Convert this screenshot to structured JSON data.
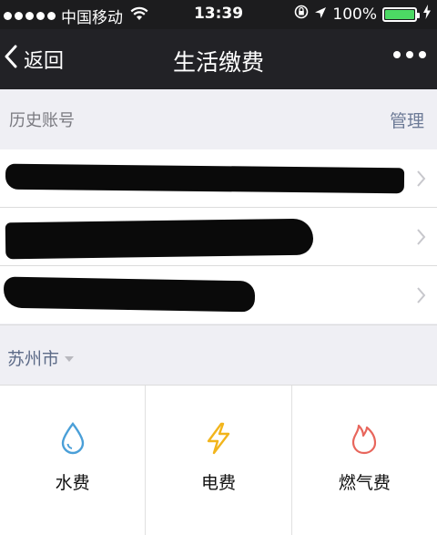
{
  "status_bar": {
    "carrier": "中国移动",
    "time": "13:39",
    "battery_text": "100%",
    "battery_level": 1.0,
    "battery_color": "#4cd964"
  },
  "nav": {
    "back_label": "返回",
    "title": "生活缴费",
    "more_icon": "more-dots-icon"
  },
  "history": {
    "label": "历史账号",
    "manage_label": "管理",
    "accounts": [
      {
        "redacted": true
      },
      {
        "redacted": true
      },
      {
        "redacted": true
      }
    ]
  },
  "city": {
    "name": "苏州市",
    "dropdown_icon": "dropdown-triangle-icon"
  },
  "services": [
    {
      "label": "水费",
      "icon": "water-drop-icon",
      "color": "#4a9fd8"
    },
    {
      "label": "电费",
      "icon": "lightning-icon",
      "color": "#f2b51c"
    },
    {
      "label": "燃气费",
      "icon": "flame-icon",
      "color": "#e8665c"
    }
  ]
}
